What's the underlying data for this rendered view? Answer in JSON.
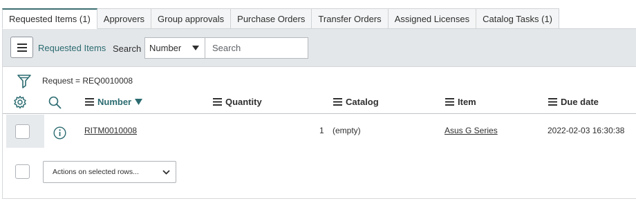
{
  "tabs": [
    {
      "label": "Requested Items (1)",
      "active": true
    },
    {
      "label": "Approvers"
    },
    {
      "label": "Group approvals"
    },
    {
      "label": "Purchase Orders"
    },
    {
      "label": "Transfer Orders"
    },
    {
      "label": "Assigned Licenses"
    },
    {
      "label": "Catalog Tasks (1)"
    }
  ],
  "list_header": {
    "title": "Requested Items",
    "search_label": "Search",
    "search_field_selected": "Number",
    "search_placeholder": "Search"
  },
  "filter": {
    "breadcrumb": "Request = REQ0010008"
  },
  "columns": [
    {
      "label": "Number",
      "sorted": "descending"
    },
    {
      "label": "Quantity"
    },
    {
      "label": "Catalog"
    },
    {
      "label": "Item"
    },
    {
      "label": "Due date"
    }
  ],
  "rows": [
    {
      "number": "RITM0010008",
      "quantity": "1",
      "catalog": "(empty)",
      "item": "Asus G Series",
      "due_date": "2022-02-03 16:30:38"
    }
  ],
  "footer": {
    "actions_label": "Actions on selected rows..."
  },
  "colors": {
    "accent": "#2b6b70",
    "bar_background": "#e4e7ea"
  },
  "icons": [
    "menu-icon",
    "filter-icon",
    "gear-icon",
    "search-icon",
    "info-icon",
    "sort-down-icon",
    "chevron-down-icon"
  ]
}
